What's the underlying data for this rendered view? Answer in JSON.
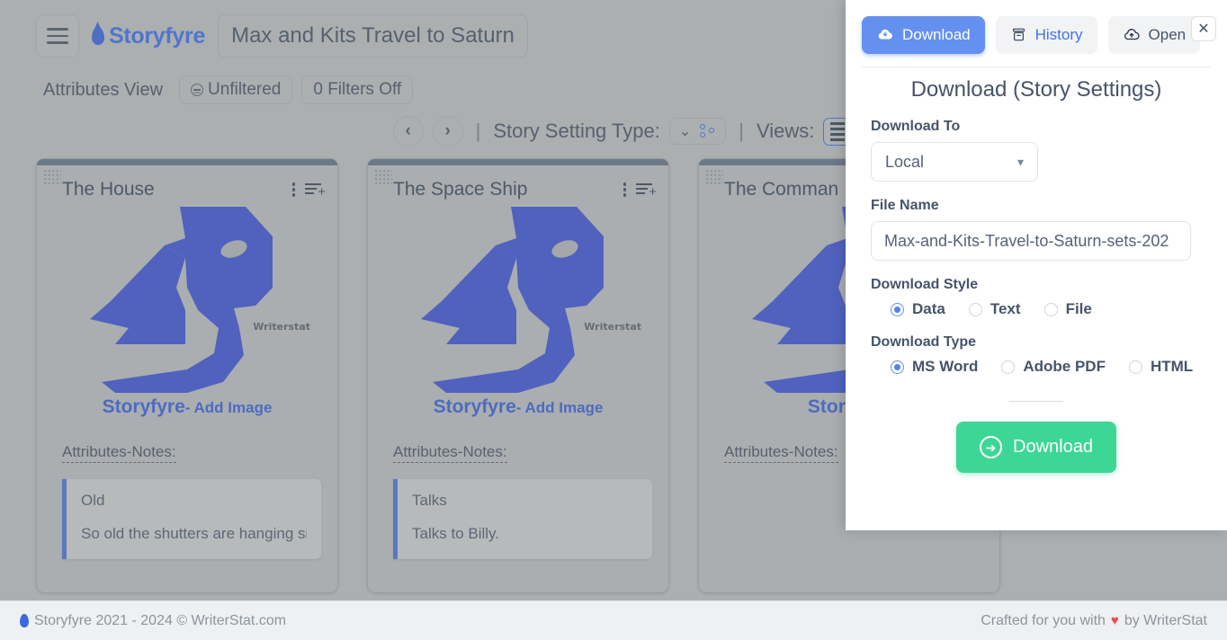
{
  "app": {
    "brand": "Storyfyre",
    "story_title": "Max and Kits Travel to Saturn",
    "view_label": "Attributes View",
    "filter_pill": "Unfiltered",
    "filters_pill": "0 Filters Off",
    "prev_icon": "‹",
    "next_icon": "›",
    "pipe": "|",
    "setting_type_label": "Story Setting Type:",
    "views_label": "Views:",
    "chevron": "⌄"
  },
  "cards": [
    {
      "title": "The House",
      "logo_caption_bold": "Storyfyre",
      "logo_caption_rest": "- Add Image",
      "watermark": "Writerstat",
      "attributes_label": "Attributes-Notes:",
      "notes": [
        "Old",
        "So old the shutters are hanging si"
      ]
    },
    {
      "title": "The Space Ship",
      "logo_caption_bold": "Storyfyre",
      "logo_caption_rest": "- Add Image",
      "watermark": "Writerstat",
      "attributes_label": "Attributes-Notes:",
      "notes": [
        "Talks",
        "Talks to Billy."
      ]
    },
    {
      "title": "The Comman",
      "logo_caption_bold": "Storyfyre",
      "logo_caption_rest": "",
      "watermark": "",
      "attributes_label": "Attributes-Notes:",
      "notes": []
    }
  ],
  "panel": {
    "tabs": [
      {
        "label": "Download",
        "icon": "cloud-download-icon",
        "active": true
      },
      {
        "label": "History",
        "icon": "archive-icon",
        "active": false
      },
      {
        "label": "Open",
        "icon": "cloud-upload-icon",
        "active": false
      }
    ],
    "close_label": "✕",
    "title": "Download (Story Settings)",
    "download_to_label": "Download To",
    "download_to_value": "Local",
    "file_name_label": "File Name",
    "file_name_value": "Max-and-Kits-Travel-to-Saturn-sets-202",
    "download_style_label": "Download Style",
    "download_style_options": [
      {
        "label": "Data",
        "selected": true
      },
      {
        "label": "Text",
        "selected": false
      },
      {
        "label": "File",
        "selected": false
      }
    ],
    "download_type_label": "Download Type",
    "download_type_options": [
      {
        "label": "MS Word",
        "selected": true
      },
      {
        "label": "Adobe PDF",
        "selected": false
      },
      {
        "label": "HTML",
        "selected": false
      }
    ],
    "submit_label": "Download"
  },
  "footer": {
    "left": "Storyfyre 2021 - 2024 © WriterStat.com",
    "right_prefix": "Crafted for you with",
    "heart": "♥",
    "right_suffix": "by WriterStat"
  },
  "colors": {
    "accent_blue": "#3f72ef",
    "tab_active": "#6490f0",
    "download_green": "#3cd695",
    "background_gray": "#c2c4c5",
    "text_dark": "#46546a"
  }
}
